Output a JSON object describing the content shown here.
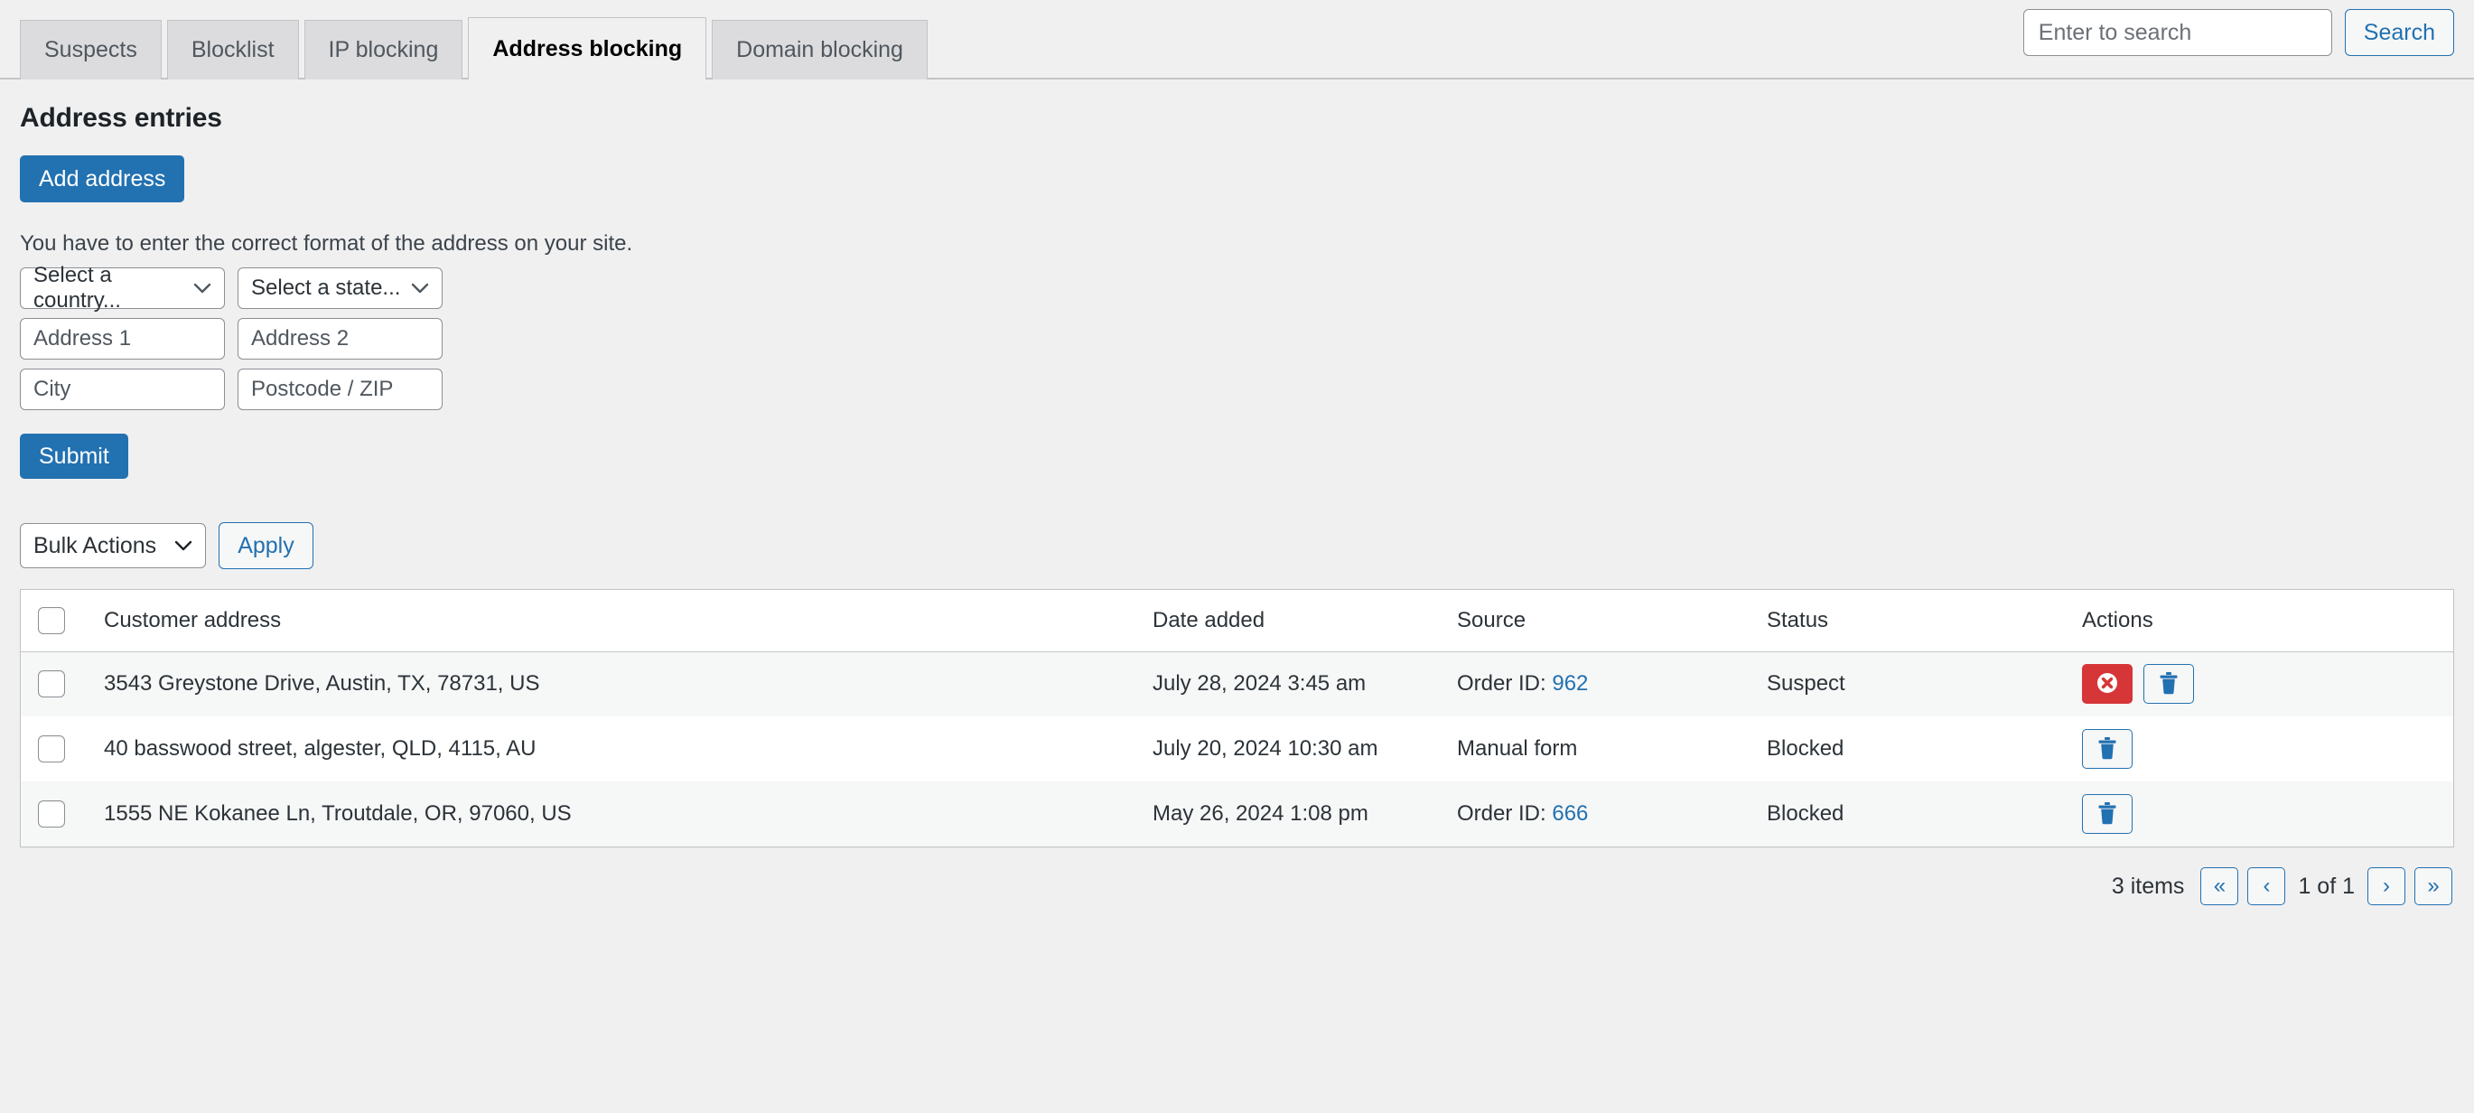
{
  "tabs": [
    {
      "label": "Suspects",
      "active": false
    },
    {
      "label": "Blocklist",
      "active": false
    },
    {
      "label": "IP blocking",
      "active": false
    },
    {
      "label": "Address blocking",
      "active": true
    },
    {
      "label": "Domain blocking",
      "active": false
    }
  ],
  "search": {
    "placeholder": "Enter to search",
    "value": "",
    "button_label": "Search"
  },
  "page": {
    "title": "Address entries",
    "add_button_label": "Add address",
    "form_hint": "You have to enter the correct format of the address on your site.",
    "submit_label": "Submit"
  },
  "form": {
    "country_placeholder": "Select a country...",
    "state_placeholder": "Select a state...",
    "address1_placeholder": "Address 1",
    "address2_placeholder": "Address 2",
    "city_placeholder": "City",
    "postcode_placeholder": "Postcode / ZIP",
    "country_value": "",
    "state_value": "",
    "address1_value": "",
    "address2_value": "",
    "city_value": "",
    "postcode_value": ""
  },
  "bulk": {
    "select_label": "Bulk Actions",
    "apply_label": "Apply"
  },
  "table": {
    "headers": {
      "address": "Customer address",
      "date": "Date added",
      "source": "Source",
      "status": "Status",
      "actions": "Actions"
    },
    "rows": [
      {
        "address": "3543 Greystone Drive, Austin, TX, 78731, US",
        "date": "July 28, 2024 3:45 am",
        "source_prefix": "Order ID: ",
        "source_link": "962",
        "source_text": "",
        "status": "Suspect",
        "has_block_action": true,
        "has_delete_action": true,
        "shade": "alt"
      },
      {
        "address": "40 basswood street, algester, QLD, 4115, AU",
        "date": "July 20, 2024 10:30 am",
        "source_prefix": "",
        "source_link": "",
        "source_text": "Manual form",
        "status": "Blocked",
        "has_block_action": false,
        "has_delete_action": true,
        "shade": "plain"
      },
      {
        "address": "1555 NE Kokanee Ln, Troutdale, OR, 97060, US",
        "date": "May 26, 2024 1:08 pm",
        "source_prefix": "Order ID: ",
        "source_link": "666",
        "source_text": "",
        "status": "Blocked",
        "has_block_action": false,
        "has_delete_action": true,
        "shade": "alt"
      }
    ]
  },
  "pagination": {
    "items_label": "3 items",
    "first_label": "«",
    "prev_label": "‹",
    "page_label": "1 of 1",
    "next_label": "›",
    "last_label": "»"
  },
  "colors": {
    "accent_blue": "#2271b1",
    "danger_red": "#d63638",
    "page_bg": "#f0f0f1",
    "row_alt_bg": "#f6f7f7",
    "border": "#c3c4c7"
  }
}
